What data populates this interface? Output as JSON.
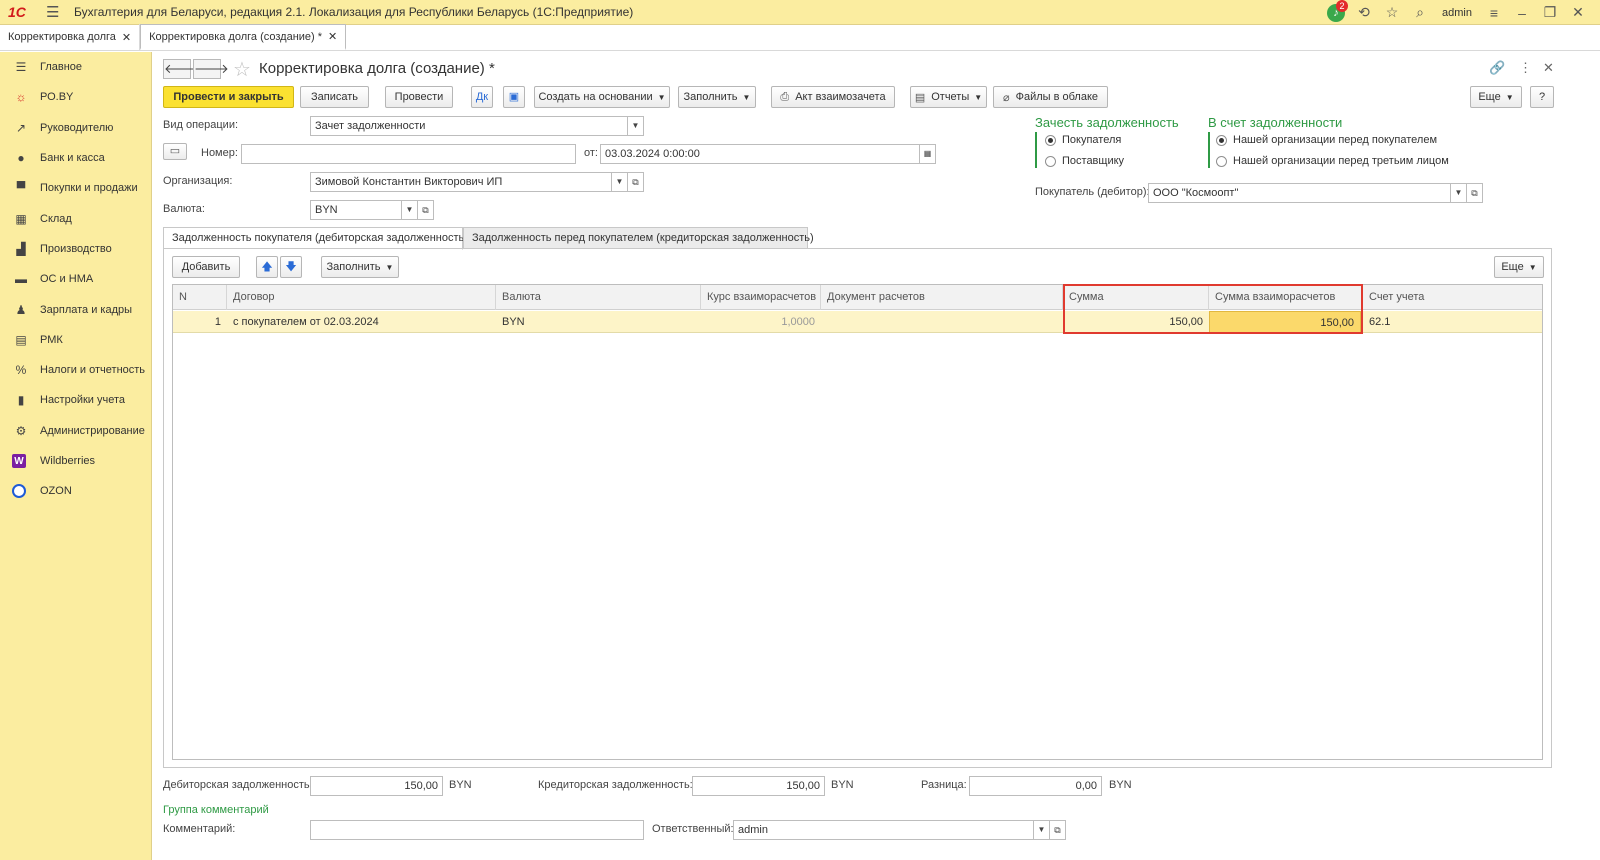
{
  "titlebar": {
    "logo": "1С",
    "app_title": "Бухгалтерия для Беларуси, редакция 2.1. Локализация для Республики Беларусь   (1С:Предприятие)",
    "notifications_count": "2",
    "user": "admin"
  },
  "open_tabs": [
    {
      "label": "Корректировка долга"
    },
    {
      "label": "Корректировка долга (создание) *"
    }
  ],
  "sidebar": {
    "items": [
      {
        "label": "Главное",
        "icon": "menu-icon"
      },
      {
        "label": "РО.BY",
        "icon": "sun-icon"
      },
      {
        "label": "Руководителю",
        "icon": "chart-icon"
      },
      {
        "label": "Банк и касса",
        "icon": "bank-icon"
      },
      {
        "label": "Покупки и продажи",
        "icon": "cart-icon"
      },
      {
        "label": "Склад",
        "icon": "warehouse-icon"
      },
      {
        "label": "Производство",
        "icon": "factory-icon"
      },
      {
        "label": "ОС и НМА",
        "icon": "truck-icon"
      },
      {
        "label": "Зарплата и кадры",
        "icon": "person-icon"
      },
      {
        "label": "РМК",
        "icon": "cash-register-icon"
      },
      {
        "label": "Налоги и отчетность",
        "icon": "taxes-icon"
      },
      {
        "label": "Настройки учета",
        "icon": "book-icon"
      },
      {
        "label": "Администрирование",
        "icon": "gear-icon"
      },
      {
        "label": "Wildberries",
        "icon": "wildberries-icon"
      },
      {
        "label": "OZON",
        "icon": "ozon-icon"
      }
    ]
  },
  "doc": {
    "title": "Корректировка долга (создание) *",
    "more_label": "Еще",
    "help_label": "?"
  },
  "toolbar": {
    "post_close": "Провести и закрыть",
    "save": "Записать",
    "post": "Провести",
    "create_based": "Создать на основании",
    "fill": "Заполнить",
    "offset_act": "Акт взаимозачета",
    "reports": "Отчеты",
    "cloud_files": "Файлы в облаке"
  },
  "form": {
    "operation_label": "Вид операции:",
    "operation_value": "Зачет задолженности",
    "number_label": "Номер:",
    "number_value": "",
    "date_label": "от:",
    "date_value": "03.03.2024  0:00:00",
    "org_label": "Организация:",
    "org_value": "Зимовой Константин Викторович ИП",
    "currency_label": "Валюта:",
    "currency_value": "BYN",
    "offset_title": "Зачесть задолженность",
    "offset_options": [
      "Покупателя",
      "Поставщику"
    ],
    "account_title": "В счет задолженности",
    "account_options": [
      "Нашей организации перед покупателем",
      "Нашей организации перед третьим лицом"
    ],
    "buyer_label": "Покупатель (дебитор):",
    "buyer_value": "ООО \"Космоопт\""
  },
  "inner_tabs": [
    {
      "label": "Задолженность покупателя (дебиторская задолженность)"
    },
    {
      "label": "Задолженность перед покупателем (кредиторская задолженность)"
    }
  ],
  "table_toolbar": {
    "add": "Добавить",
    "fill": "Заполнить",
    "more": "Еще"
  },
  "table": {
    "columns": [
      "N",
      "Договор",
      "Валюта",
      "Курс взаиморасчетов",
      "Документ расчетов",
      "Сумма",
      "Сумма взаиморасчетов",
      "Счет учета"
    ],
    "rows": [
      {
        "n": "1",
        "contract": "с покупателем от 02.03.2024",
        "currency": "BYN",
        "rate": "1,0000",
        "doc": "",
        "sum": "150,00",
        "settle_sum": "150,00",
        "account": "62.1"
      }
    ]
  },
  "totals": {
    "debit_label": "Дебиторская задолженность:",
    "debit_value": "150,00",
    "debit_cur": "BYN",
    "credit_label": "Кредиторская задолженность:",
    "credit_value": "150,00",
    "credit_cur": "BYN",
    "diff_label": "Разница:",
    "diff_value": "0,00",
    "diff_cur": "BYN"
  },
  "footer": {
    "comments_group": "Группа комментарий",
    "comment_label": "Комментарий:",
    "comment_value": "",
    "responsible_label": "Ответственный:",
    "responsible_value": "admin"
  }
}
